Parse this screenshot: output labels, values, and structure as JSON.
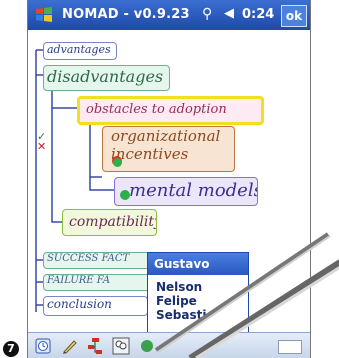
{
  "titlebar": {
    "title": "NOMAD - v0.9.23",
    "signal_icon": "signal-icon",
    "volume_icon": "volume-icon",
    "time": "0:24",
    "ok_label": "ok"
  },
  "mindmap": {
    "nodes": {
      "advantages": "advantages",
      "disadvantages": "disadvantages",
      "obstacles": "obstacles to adoption",
      "organizational": "organizational incentives",
      "mental_models": "mental models",
      "compatibility": "compatibility",
      "success": "SUCCESS FACT",
      "failure": "FAILURE FA",
      "conclusion": "conclusion"
    },
    "colors": {
      "selected_border": "#f0e020",
      "obstacles_fill": "#fdeaf2",
      "organizational_fill": "#f8e4d2",
      "mental_fill": "#ece6fa",
      "compat_fill": "#f1f9da"
    }
  },
  "popup": {
    "header": "Gustavo",
    "items": [
      "Nelson",
      "Felipe",
      "Sebasti"
    ]
  },
  "toolbar": {
    "icons": [
      "clock-icon",
      "pen-icon",
      "hierarchy-icon",
      "people-icon",
      "keyboard-icon"
    ]
  },
  "step_number": "7"
}
